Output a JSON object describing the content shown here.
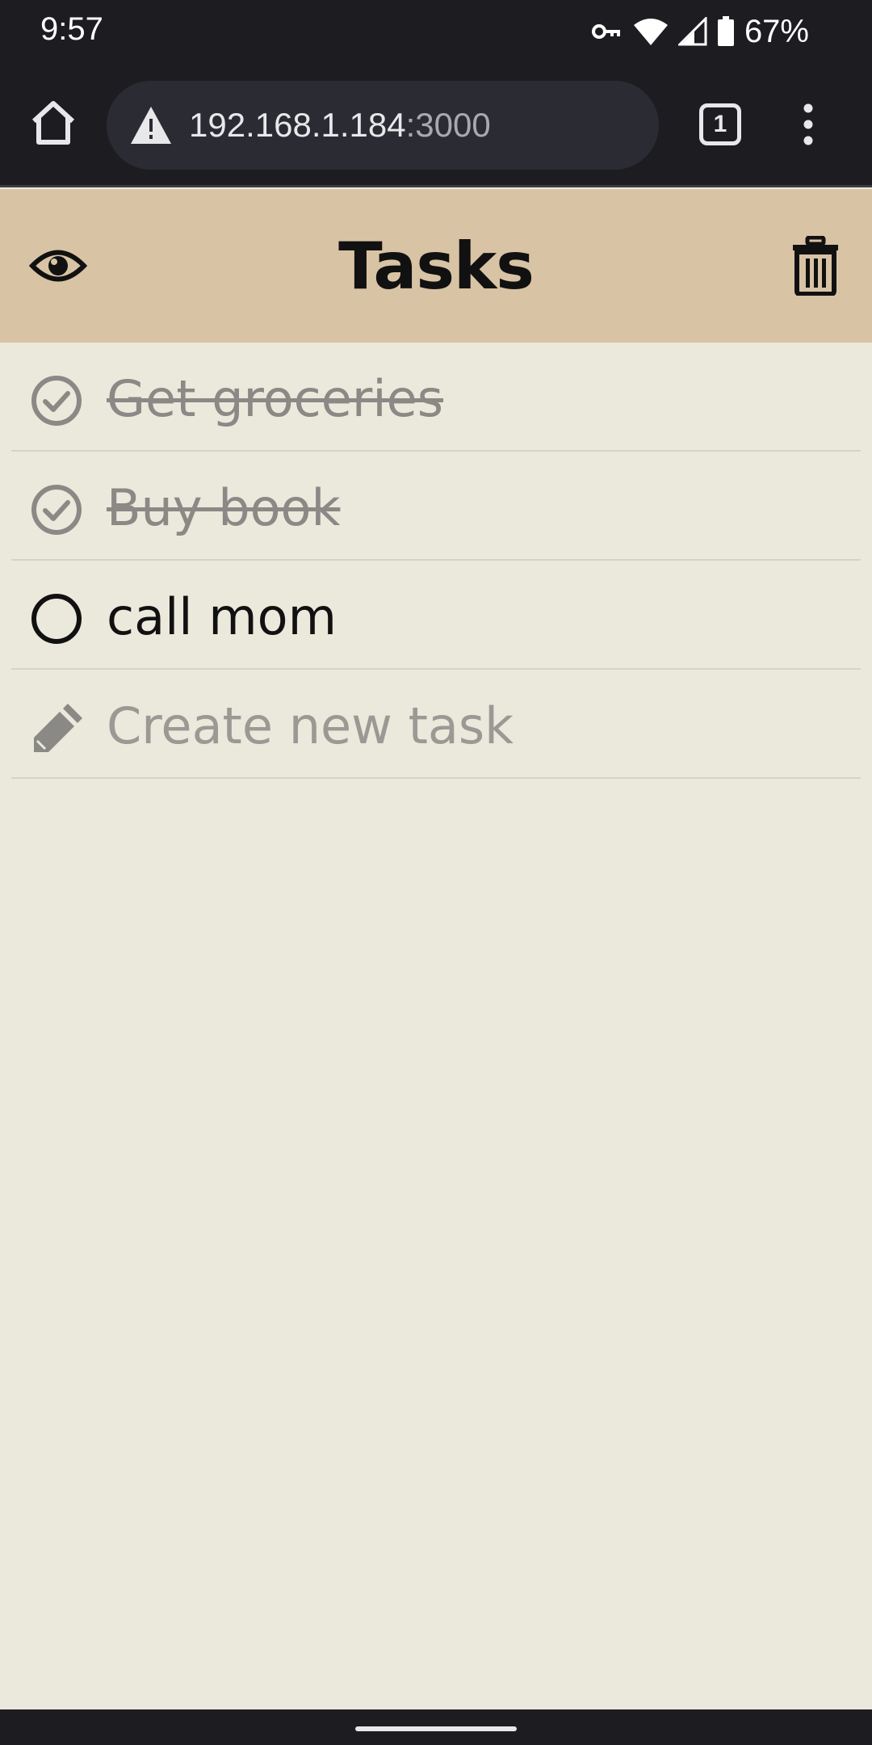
{
  "status_bar": {
    "time": "9:57",
    "battery": "67%",
    "icons": [
      "vpn-key-icon",
      "wifi-icon",
      "cell-signal-icon",
      "battery-icon"
    ]
  },
  "browser": {
    "url_host": "192.168.1.184",
    "url_port": ":3000",
    "tab_count": "1",
    "icons": [
      "home-icon",
      "warning-icon",
      "tabs-icon",
      "more-vert-icon"
    ]
  },
  "app": {
    "title": "Tasks",
    "header_color": "#d8c3a4",
    "background_color": "#ebe8dc",
    "icons": [
      "eye-icon",
      "trash-icon"
    ]
  },
  "tasks": [
    {
      "label": "Get groceries",
      "done": true
    },
    {
      "label": "Buy book",
      "done": true
    },
    {
      "label": "call mom",
      "done": false
    }
  ],
  "new_task": {
    "placeholder": "Create new task",
    "icon": "pencil-icon"
  }
}
